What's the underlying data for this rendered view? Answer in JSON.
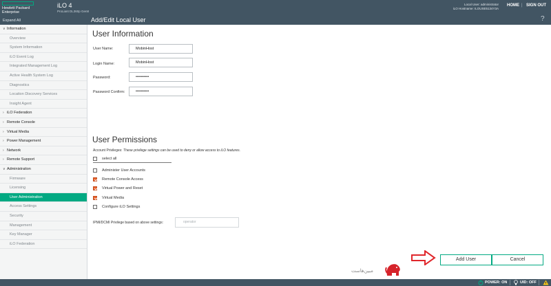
{
  "header": {
    "brand_line1": "Hewlett Packard",
    "brand_line2": "Enterprise",
    "product_name": "iLO 4",
    "product_sub": "ProLiant DL360p Gen8",
    "local_user": "Local User: administrator",
    "ilo_hostname": "iLO Hostname: ILOUSE5134Y3A",
    "home_label": "HOME",
    "separator": "|",
    "signout_label": "SIGN OUT",
    "brand_color": "#01a982"
  },
  "subheader": {
    "expand_all": "Expand All",
    "page_title": "Add/Edit Local User",
    "help_icon": "?"
  },
  "sidebar": {
    "items": [
      {
        "label": "Information",
        "type": "section",
        "expanded": true
      },
      {
        "label": "Overview",
        "type": "sub"
      },
      {
        "label": "System Information",
        "type": "sub"
      },
      {
        "label": "iLO Event Log",
        "type": "sub"
      },
      {
        "label": "Integrated Management Log",
        "type": "sub"
      },
      {
        "label": "Active Health System Log",
        "type": "sub"
      },
      {
        "label": "Diagnostics",
        "type": "sub"
      },
      {
        "label": "Location Discovery Services",
        "type": "sub"
      },
      {
        "label": "Insight Agent",
        "type": "sub"
      },
      {
        "label": "iLO Federation",
        "type": "section",
        "expanded": false
      },
      {
        "label": "Remote Console",
        "type": "section",
        "expanded": false
      },
      {
        "label": "Virtual Media",
        "type": "section",
        "expanded": false
      },
      {
        "label": "Power Management",
        "type": "section",
        "expanded": false
      },
      {
        "label": "Network",
        "type": "section",
        "expanded": false
      },
      {
        "label": "Remote Support",
        "type": "section",
        "expanded": false
      },
      {
        "label": "Administration",
        "type": "section",
        "expanded": true
      },
      {
        "label": "Firmware",
        "type": "sub"
      },
      {
        "label": "Licensing",
        "type": "sub"
      },
      {
        "label": "User Administration",
        "type": "sub",
        "active": true
      },
      {
        "label": "Access Settings",
        "type": "sub"
      },
      {
        "label": "Security",
        "type": "sub"
      },
      {
        "label": "Management",
        "type": "sub"
      },
      {
        "label": "Key Manager",
        "type": "sub"
      },
      {
        "label": "iLO Federation",
        "type": "sub"
      }
    ]
  },
  "user_info": {
    "title": "User Information",
    "user_name_label": "User Name:",
    "user_name_value": "MobinHost",
    "login_name_label": "Login Name:",
    "login_name_value": "MobinHost",
    "password_label": "Password:",
    "password_value": "••••••••••",
    "password_confirm_label": "Password Confirm:",
    "password_confirm_value": "••••••••••"
  },
  "permissions": {
    "title": "User Permissions",
    "account_privileges_label": "Account Privileges:",
    "account_privileges_desc": "These privilege settings can be used to deny or allow access to iLO features.",
    "select_all": "select all",
    "items": [
      {
        "label": "Administer User Accounts",
        "checked": false
      },
      {
        "label": "Remote Console Access",
        "checked": true
      },
      {
        "label": "Virtual Power and Reset",
        "checked": true
      },
      {
        "label": "Virtual Media",
        "checked": true
      },
      {
        "label": "Configure iLO Settings",
        "checked": false
      }
    ],
    "ipmi_label": "IPMI/DCMI Privilege based on above settings:",
    "ipmi_value": "operator"
  },
  "buttons": {
    "add_user": "Add User",
    "cancel": "Cancel"
  },
  "watermark": {
    "text": "مبین‌هاست"
  },
  "statusbar": {
    "power_label": "POWER: ON",
    "uid_label": "UID: OFF",
    "power_color": "#01a982",
    "warning_color": "#f5c518"
  }
}
